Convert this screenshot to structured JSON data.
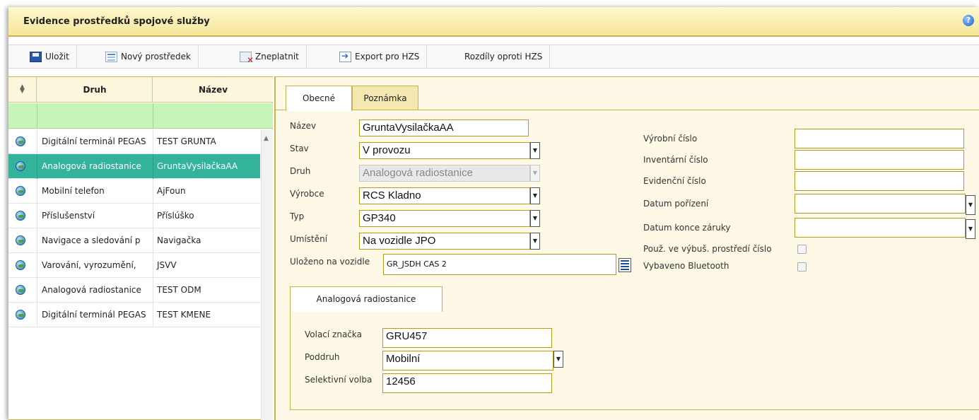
{
  "window": {
    "title": "Evidence prostředků spojové služby"
  },
  "toolbar": {
    "save": "Uložit",
    "new": "Nový prostředek",
    "invalidate": "Zneplatnit",
    "export": "Export pro HZS",
    "diff": "Rozdíly oproti HZS"
  },
  "grid": {
    "columns": [
      "Druh",
      "Název"
    ],
    "rows": [
      {
        "druh": "Digitální terminál PEGAS",
        "nazev": "TEST GRUNTA",
        "selected": false
      },
      {
        "druh": "Analogová radiostanice",
        "nazev": "GruntaVysilačkaAA",
        "selected": true
      },
      {
        "druh": "Mobilní telefon",
        "nazev": "AjFoun",
        "selected": false
      },
      {
        "druh": "Příslušenství",
        "nazev": "Příslúško",
        "selected": false
      },
      {
        "druh": "Navigace a sledování p",
        "nazev": "Navigačka",
        "selected": false
      },
      {
        "druh": "Varování, vyrozumění,",
        "nazev": "JSVV",
        "selected": false
      },
      {
        "druh": "Analogová radiostanice",
        "nazev": "TEST ODM",
        "selected": false
      },
      {
        "druh": "Digitální terminál PEGAS",
        "nazev": "TEST KMENE",
        "selected": false
      }
    ]
  },
  "tabs": {
    "general": "Obecné",
    "note": "Poznámka"
  },
  "form": {
    "nazev_label": "Název",
    "nazev_value": "GruntaVysilačkaAA",
    "stav_label": "Stav",
    "stav_value": "V provozu",
    "druh_label": "Druh",
    "druh_value": "Analogová radiostanice",
    "vyrobce_label": "Výrobce",
    "vyrobce_value": "RCS Kladno",
    "typ_label": "Typ",
    "typ_value": "GP340",
    "umisteni_label": "Umístění",
    "umisteni_value": "Na vozidle JPO",
    "ulozeno_label": "Uloženo na vozidle",
    "ulozeno_value": "GR_JSDH CAS 2",
    "vyrobni_label": "Výrobní číslo",
    "vyrobni_value": "",
    "inventarni_label": "Inventární číslo",
    "inventarni_value": "",
    "evidencni_label": "Evidenční číslo",
    "evidencni_value": "",
    "datum_porizeni_label": "Datum pořízení",
    "datum_porizeni_value": "",
    "datum_zaruky_label": "Datum konce záruky",
    "datum_zaruky_value": "",
    "vybus_label": "Použ. ve výbuš. prostředí číslo",
    "bluetooth_label": "Vybaveno Bluetooth"
  },
  "subtab": {
    "title": "Analogová radiostanice"
  },
  "subform": {
    "volaci_label": "Volací značka",
    "volaci_value": "GRU457",
    "poddruh_label": "Poddruh",
    "poddruh_value": "Mobilní",
    "selektivni_label": "Selektivní volba",
    "selektivni_value": "12456"
  },
  "icons": {
    "save": "floppy-disk-icon",
    "new": "new-item-icon",
    "invalidate": "invalidate-icon",
    "export": "export-icon",
    "help": "help-icon",
    "calendar": "calendar-icon",
    "row": "radio-device-icon"
  },
  "colors": {
    "accent": "#c9b24a",
    "selected_row": "#33b39c",
    "filter_row": "#c7f4b8",
    "panel_bg": "#fdf9e6"
  }
}
